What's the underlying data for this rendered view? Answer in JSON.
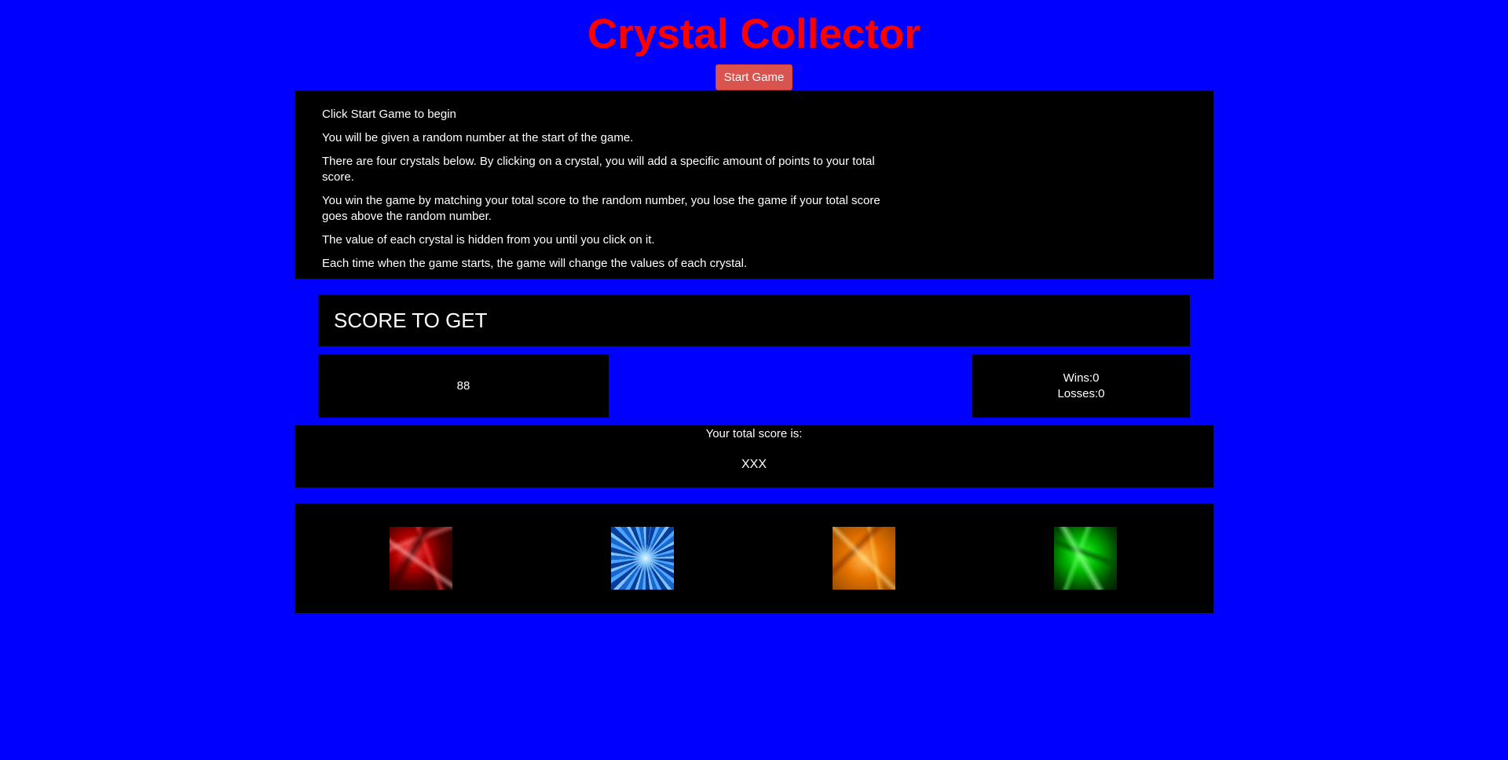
{
  "game": {
    "title": "Crystal Collector",
    "start_button_label": "Start Game"
  },
  "instructions": [
    "Click Start Game to begin",
    "You will be given a random number at the start of the game.",
    "There are four crystals below. By clicking on a crystal, you will add a specific amount of points to your total score.",
    "You win the game by matching your total score to the random number, you lose the game if your total score goes above the random number.",
    "The value of each crystal is hidden from you until you click on it.",
    "Each time when the game starts, the game will change the values of each crystal."
  ],
  "score_to_get": {
    "heading": "SCORE TO GET",
    "value": "88"
  },
  "record": {
    "wins": "Wins:0",
    "losses": "Losses:0"
  },
  "total_score": {
    "label": "Your total score is:",
    "value": "XXX"
  },
  "crystals": [
    {
      "name": "red-crystal",
      "color": "#b30000"
    },
    {
      "name": "blue-crystal",
      "color": "#1a66cc"
    },
    {
      "name": "orange-crystal",
      "color": "#e67300"
    },
    {
      "name": "green-crystal",
      "color": "#00b300"
    }
  ],
  "colors": {
    "background": "#0000ff",
    "title": "#ff0000",
    "panel": "#000000",
    "button": "#d9534f",
    "text": "#ffffff"
  }
}
